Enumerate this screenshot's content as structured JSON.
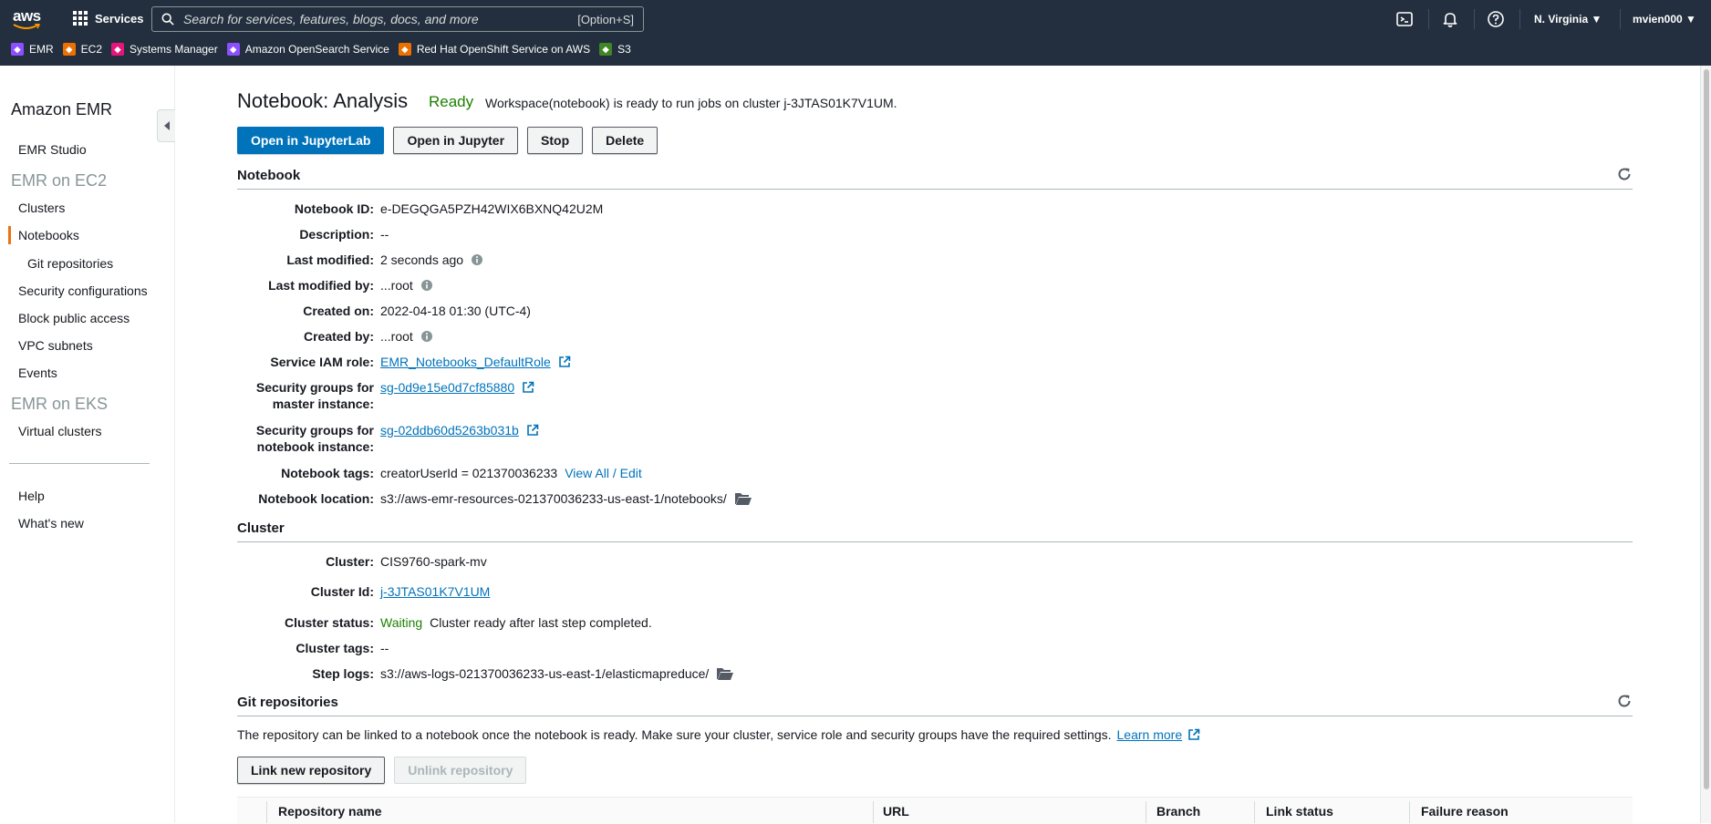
{
  "topbar": {
    "logo": "aws",
    "services_label": "Services",
    "search_placeholder": "Search for services, features, blogs, docs, and more",
    "search_shortcut": "[Option+S]",
    "region": "N. Virginia ▼",
    "user": "mvien000 ▼",
    "favorites": [
      {
        "label": "EMR",
        "color": "#8c4fff"
      },
      {
        "label": "EC2",
        "color": "#ed7100"
      },
      {
        "label": "Systems Manager",
        "color": "#e7157b"
      },
      {
        "label": "Amazon OpenSearch Service",
        "color": "#8c4fff"
      },
      {
        "label": "Red Hat OpenShift Service on AWS",
        "color": "#ed7100"
      },
      {
        "label": "S3",
        "color": "#3f8624"
      }
    ]
  },
  "sidebar": {
    "title": "Amazon EMR",
    "emr_studio": "EMR Studio",
    "group_ec2": "EMR on EC2",
    "clusters": "Clusters",
    "notebooks": "Notebooks",
    "git_repositories": "Git repositories",
    "security_configurations": "Security configurations",
    "block_public_access": "Block public access",
    "vpc_subnets": "VPC subnets",
    "events": "Events",
    "group_eks": "EMR on EKS",
    "virtual_clusters": "Virtual clusters",
    "help": "Help",
    "whats_new": "What's new"
  },
  "page": {
    "title": "Notebook: Analysis",
    "status": "Ready",
    "status_message": "Workspace(notebook) is ready to run jobs on cluster j-3JTAS01K7V1UM.",
    "buttons": {
      "open_jupyterlab": "Open in JupyterLab",
      "open_jupyter": "Open in Jupyter",
      "stop": "Stop",
      "delete": "Delete"
    }
  },
  "notebook": {
    "section_title": "Notebook",
    "labels": {
      "id": "Notebook ID:",
      "description": "Description:",
      "last_modified": "Last modified:",
      "last_modified_by": "Last modified by:",
      "created_on": "Created on:",
      "created_by": "Created by:",
      "service_role": "Service IAM role:",
      "sg_master_1": "Security groups for",
      "sg_master_2": "master instance:",
      "sg_notebook_1": "Security groups for",
      "sg_notebook_2": "notebook instance:",
      "tags": "Notebook tags:",
      "location": "Notebook location:"
    },
    "values": {
      "id": "e-DEGQGA5PZH42WIX6BXNQ42U2M",
      "description": "--",
      "last_modified": "2 seconds ago",
      "last_modified_by": "...root",
      "created_on": "2022-04-18 01:30 (UTC-4)",
      "created_by": "...root",
      "service_role": "EMR_Notebooks_DefaultRole",
      "sg_master": "sg-0d9e15e0d7cf85880",
      "sg_notebook": "sg-02ddb60d5263b031b",
      "tags": "creatorUserId = 021370036233",
      "tags_link": "View All / Edit",
      "location": "s3://aws-emr-resources-021370036233-us-east-1/notebooks/"
    }
  },
  "cluster": {
    "section_title": "Cluster",
    "labels": {
      "cluster": "Cluster:",
      "cluster_id": "Cluster Id:",
      "status": "Cluster status:",
      "tags": "Cluster tags:",
      "step_logs": "Step logs:"
    },
    "values": {
      "cluster": "CIS9760-spark-mv",
      "cluster_id": "j-3JTAS01K7V1UM",
      "status": "Waiting",
      "status_message": "Cluster ready after last step completed.",
      "tags": "--",
      "step_logs": "s3://aws-logs-021370036233-us-east-1/elasticmapreduce/"
    }
  },
  "git": {
    "section_title": "Git repositories",
    "description": "The repository can be linked to a notebook once the notebook is ready. Make sure your cluster, service role and security groups have the required settings.",
    "learn_more": "Learn more",
    "link_button": "Link new repository",
    "unlink_button": "Unlink repository",
    "columns": [
      "Repository name",
      "URL",
      "Branch",
      "Link status",
      "Failure reason"
    ]
  }
}
